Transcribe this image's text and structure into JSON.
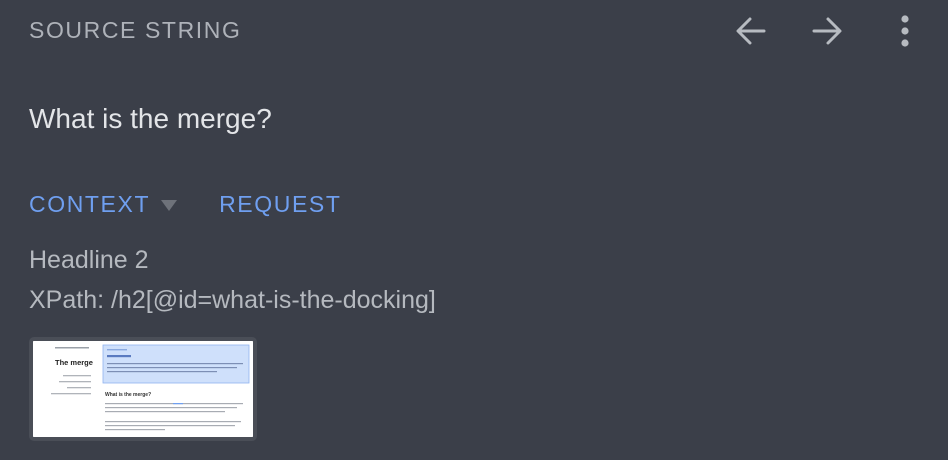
{
  "header": {
    "title": "SOURCE STRING",
    "icons": {
      "back": "arrow-left-icon",
      "forward": "arrow-right-icon",
      "more": "more-vertical-icon"
    }
  },
  "source": {
    "text": "What is the merge?"
  },
  "tabs": [
    {
      "label": "CONTEXT",
      "has_dropdown": true
    },
    {
      "label": "REQUEST",
      "has_dropdown": false
    }
  ],
  "context": {
    "element_type": "Headline 2",
    "xpath": "XPath: /h2[@id=what-is-the-docking]"
  },
  "screenshot_thumbnail": {
    "page_title": "The merge",
    "section_heading": "What is the merge?"
  },
  "colors": {
    "background": "#3b3f49",
    "accent": "#6f9ff0",
    "muted_text": "#aeb2b9",
    "primary_text": "#e3e5e8"
  }
}
